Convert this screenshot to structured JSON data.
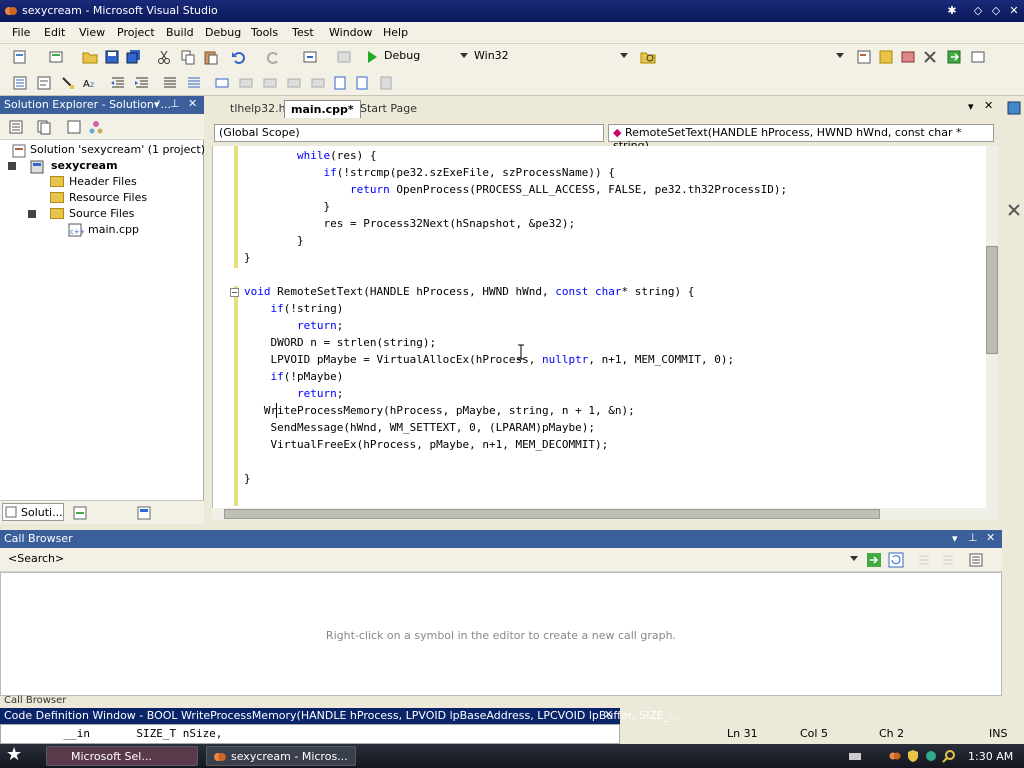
{
  "window": {
    "title": "sexycream - Microsoft Visual Studio"
  },
  "menu": [
    "File",
    "Edit",
    "View",
    "Project",
    "Build",
    "Debug",
    "Tools",
    "Test",
    "Window",
    "Help"
  ],
  "toolbar": {
    "config": "Debug",
    "platform": "Win32"
  },
  "solution_explorer": {
    "title": "Solution Explorer - Solution '...",
    "solution": "Solution 'sexycream' (1 project)",
    "project": "sexycream",
    "folders": [
      "Header Files",
      "Resource Files",
      "Source Files"
    ],
    "file": "main.cpp",
    "bottom_tab": "Soluti..."
  },
  "editor": {
    "tabs": [
      "tlhelp32.h",
      "main.cpp*",
      "Start Page"
    ],
    "scope": "(Global Scope)",
    "member": "RemoteSetText(HANDLE hProcess, HWND hWnd, const char * string)"
  },
  "code": [
    {
      "indent": "        ",
      "parts": [
        [
          "kw",
          "while"
        ],
        [
          "t",
          "(res) {"
        ]
      ]
    },
    {
      "indent": "            ",
      "parts": [
        [
          "kw",
          "if"
        ],
        [
          "t",
          "(!strcmp(pe32.szExeFile, szProcessName)) {"
        ]
      ]
    },
    {
      "indent": "                ",
      "parts": [
        [
          "kw",
          "return"
        ],
        [
          "t",
          " OpenProcess(PROCESS_ALL_ACCESS, FALSE, pe32.th32ProcessID);"
        ]
      ]
    },
    {
      "indent": "            ",
      "parts": [
        [
          "t",
          "}"
        ]
      ]
    },
    {
      "indent": "            ",
      "parts": [
        [
          "t",
          "res = Process32Next(hSnapshot, &pe32);"
        ]
      ]
    },
    {
      "indent": "        ",
      "parts": [
        [
          "t",
          "}"
        ]
      ]
    },
    {
      "indent": "",
      "parts": [
        [
          "t",
          "}"
        ]
      ]
    },
    {
      "indent": "",
      "parts": []
    },
    {
      "indent": "",
      "parts": [
        [
          "kw",
          "void"
        ],
        [
          "t",
          " RemoteSetText(HANDLE hProcess, HWND hWnd, "
        ],
        [
          "kw",
          "const"
        ],
        [
          "t",
          " "
        ],
        [
          "kw",
          "char"
        ],
        [
          "t",
          "* string) {"
        ]
      ]
    },
    {
      "indent": "    ",
      "parts": [
        [
          "kw",
          "if"
        ],
        [
          "t",
          "(!string)"
        ]
      ]
    },
    {
      "indent": "        ",
      "parts": [
        [
          "kw",
          "return"
        ],
        [
          "t",
          ";"
        ]
      ]
    },
    {
      "indent": "    ",
      "parts": [
        [
          "t",
          "DWORD n = strlen(string);"
        ]
      ]
    },
    {
      "indent": "    ",
      "parts": [
        [
          "t",
          "LPVOID pMaybe = VirtualAllocEx(hProcess, "
        ],
        [
          "kw",
          "nullptr"
        ],
        [
          "t",
          ", n+1, MEM_COMMIT, 0);"
        ]
      ]
    },
    {
      "indent": "    ",
      "parts": [
        [
          "kw",
          "if"
        ],
        [
          "t",
          "(!pMaybe)"
        ]
      ]
    },
    {
      "indent": "        ",
      "parts": [
        [
          "kw",
          "return"
        ],
        [
          "t",
          ";"
        ]
      ]
    },
    {
      "indent": "   ",
      "parts": [
        [
          "t",
          "WriteProcessMemory(hProcess, pMaybe, string, n + 1, &n);"
        ]
      ]
    },
    {
      "indent": "    ",
      "parts": [
        [
          "t",
          "SendMessage(hWnd, WM_SETTEXT, 0, (LPARAM)pMaybe);"
        ]
      ]
    },
    {
      "indent": "    ",
      "parts": [
        [
          "t",
          "VirtualFreeEx(hProcess, pMaybe, n+1, MEM_DECOMMIT);"
        ]
      ]
    },
    {
      "indent": "",
      "parts": []
    },
    {
      "indent": "",
      "parts": [
        [
          "t",
          "}"
        ]
      ]
    }
  ],
  "call_browser": {
    "title": "Call Browser",
    "search": "<Search>",
    "message": "Right-click on a symbol in the editor to create a new call graph.",
    "tab": "Call Browser"
  },
  "code_definition": {
    "title": "Code Definition Window - BOOL WriteProcessMemory(HANDLE hProcess, LPVOID lpBaseAddress, LPCVOID lpBuffer, SIZE_...",
    "line": "    __in       SIZE_T nSize,"
  },
  "status": {
    "ln": "Ln 31",
    "col": "Col 5",
    "ch": "Ch 2",
    "mode": "INS"
  },
  "taskbar": {
    "task1": "Microsoft Sel...",
    "task2": "sexycream - Micros...",
    "clock": "1:30 AM"
  }
}
